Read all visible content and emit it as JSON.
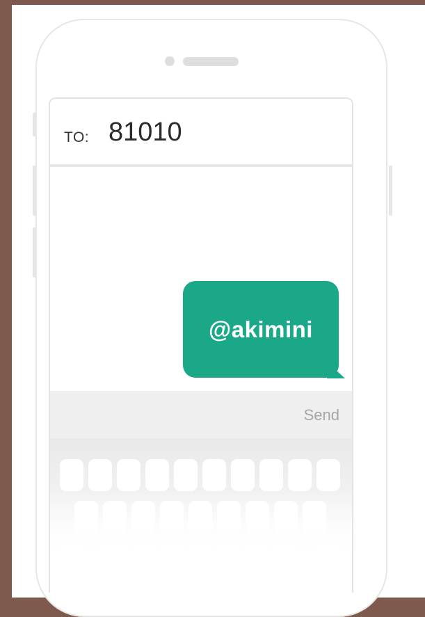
{
  "compose": {
    "to_label": "TO:",
    "recipient": "81010"
  },
  "message": {
    "text": "@akimini",
    "bubble_color": "#1ba889"
  },
  "send_bar": {
    "send_label": "Send"
  },
  "theme": {
    "background": "#7d5a4d",
    "phone_outline": "#e6e6e6"
  },
  "icons": {
    "speaker": "phone-speaker-icon",
    "camera": "phone-camera-dot-icon"
  }
}
